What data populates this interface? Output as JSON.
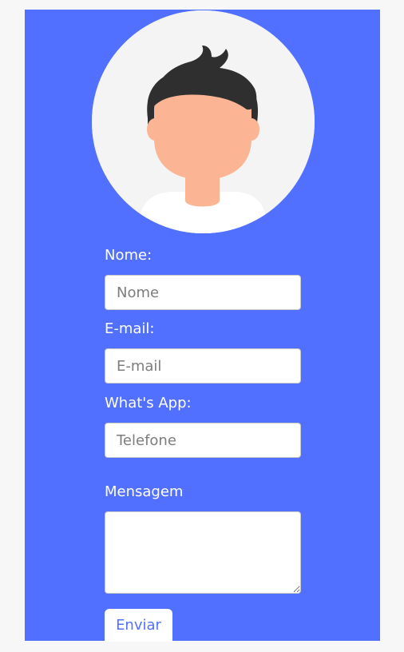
{
  "form": {
    "name_label": "Nome:",
    "name_placeholder": "Nome",
    "email_label": "E-mail:",
    "email_placeholder": "E-mail",
    "whatsapp_label": "What's App:",
    "phone_placeholder": "Telefone",
    "message_label": "Mensagem",
    "submit_label": "Enviar"
  },
  "colors": {
    "panel_background": "#5270ff",
    "page_background": "#f7f7f7",
    "button_text": "#5270ff"
  },
  "avatar": {
    "icon": "person-avatar"
  }
}
